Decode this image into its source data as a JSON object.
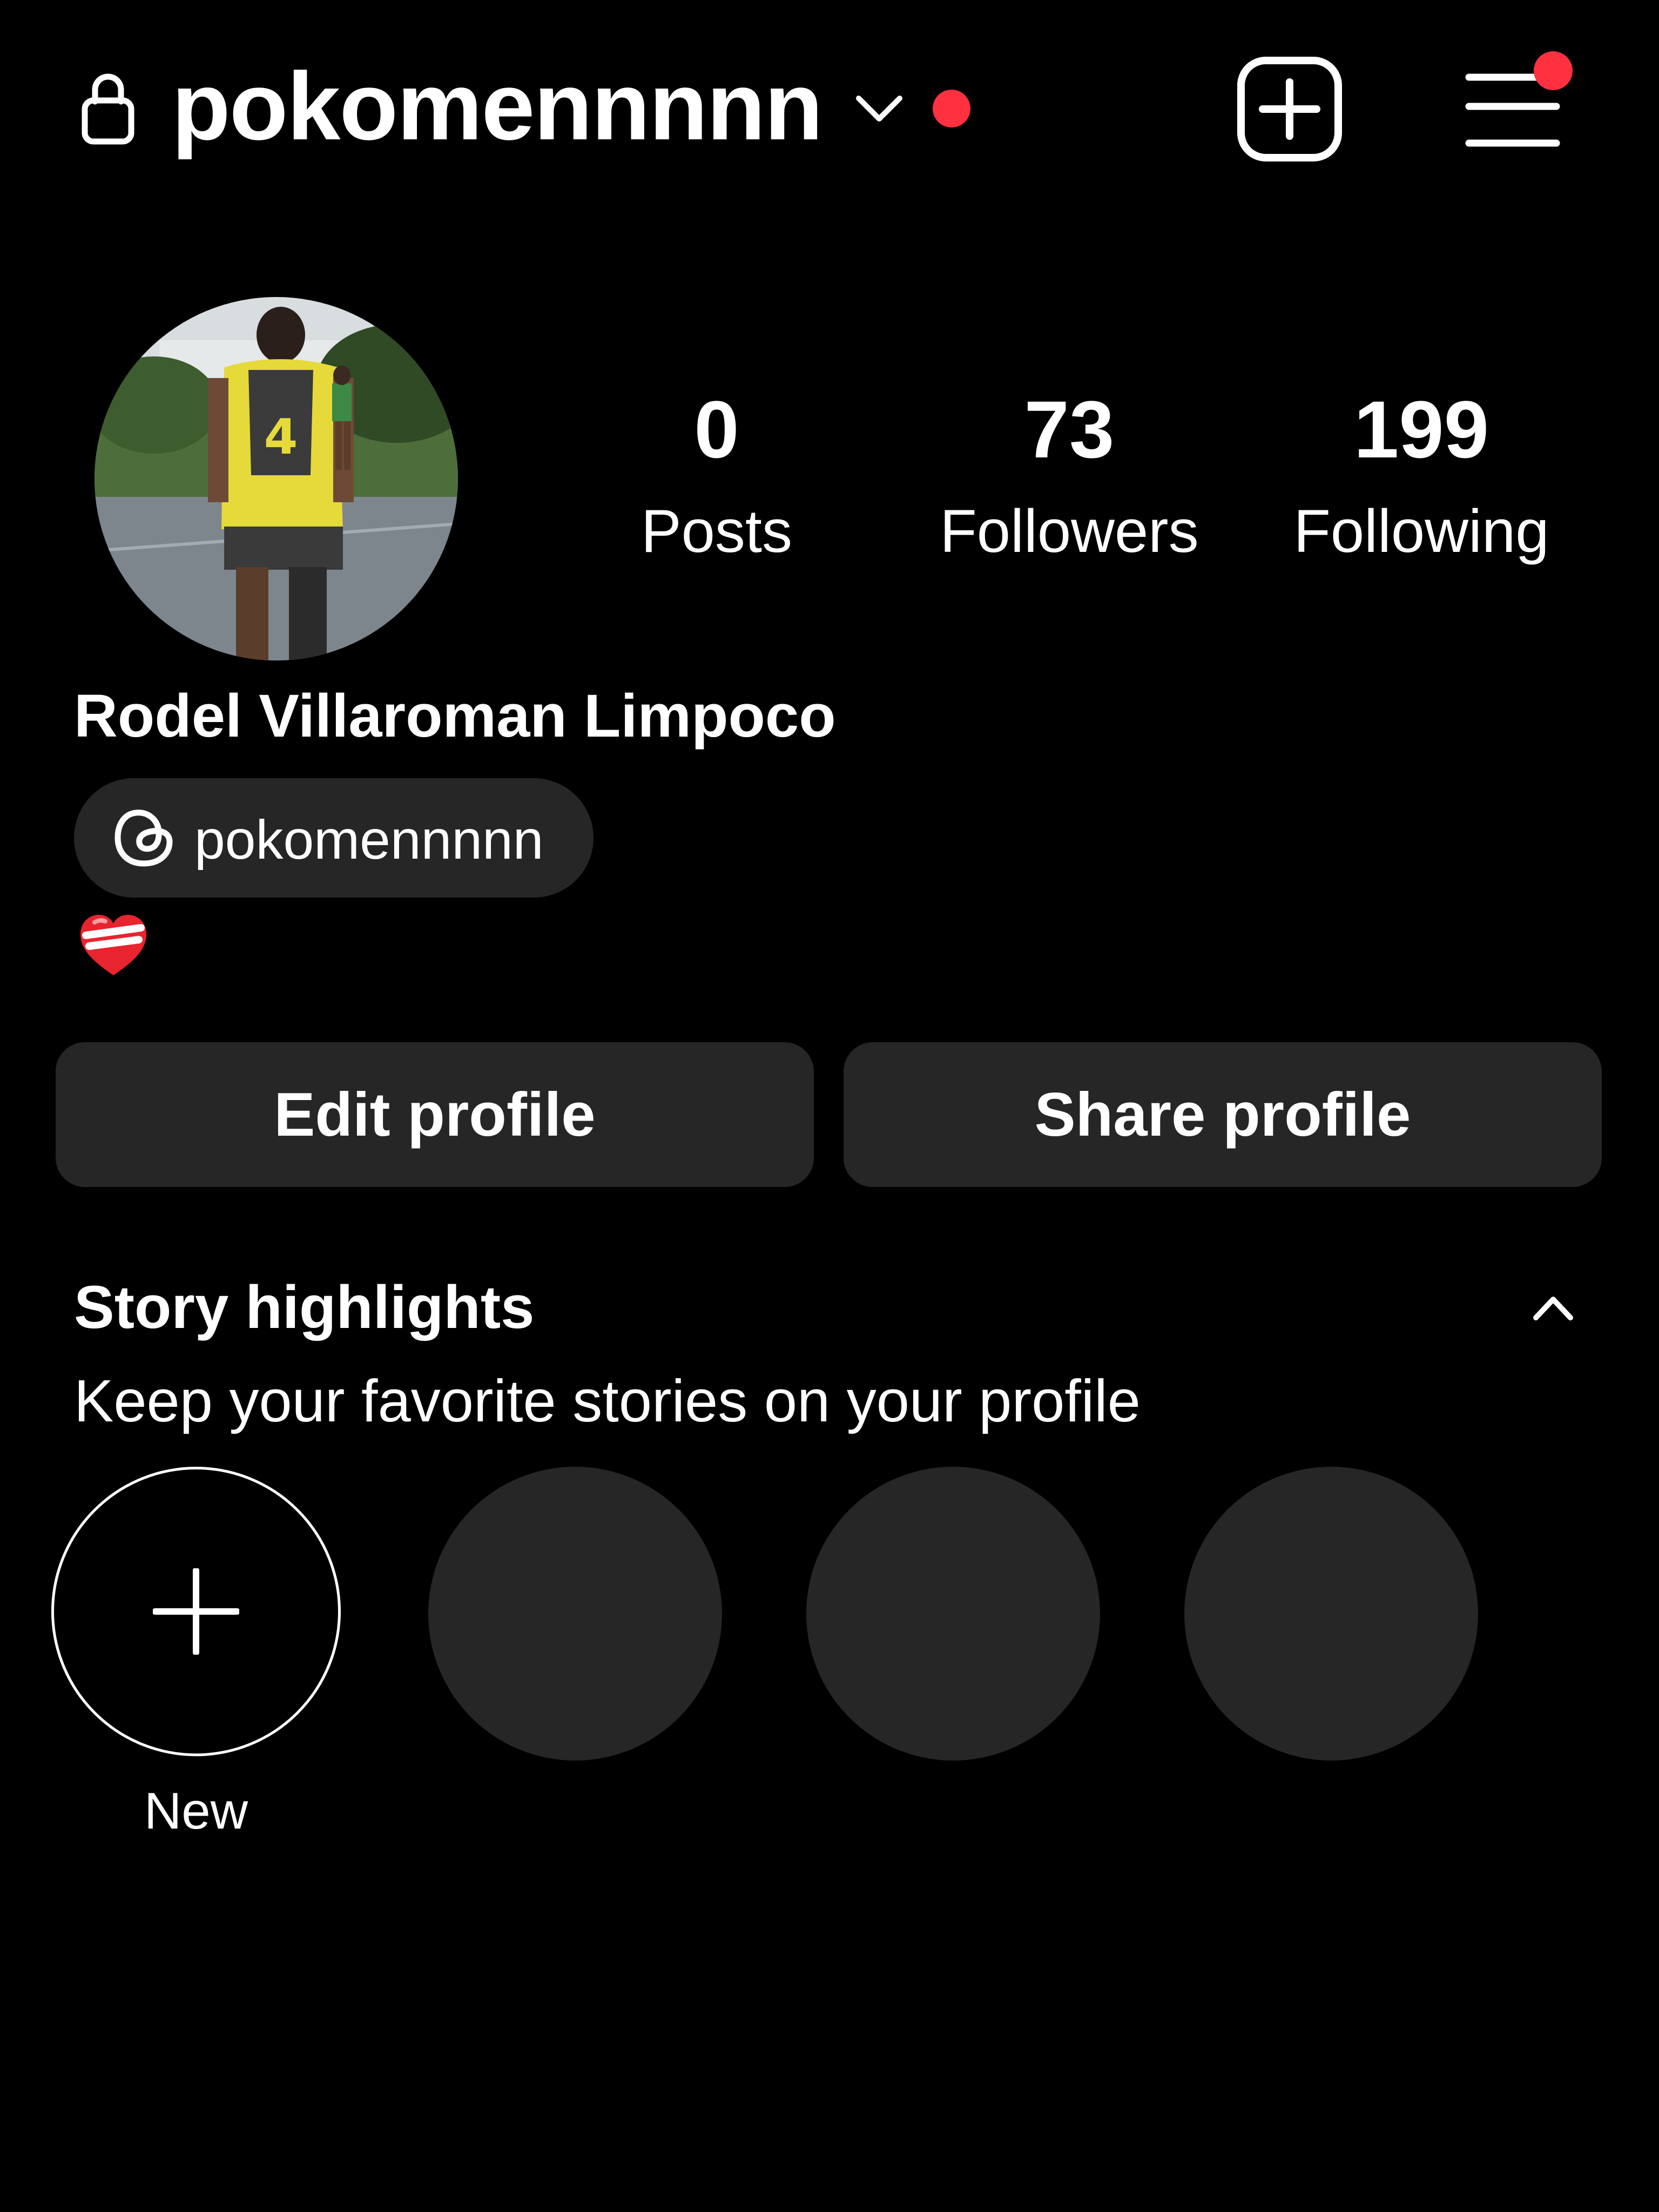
{
  "header": {
    "username": "pokomennnnn",
    "lock_icon": "lock-icon",
    "dropdown_icon": "chevron-down-icon",
    "create_icon": "plus-square-icon",
    "menu_icon": "hamburger-menu-icon"
  },
  "profile": {
    "avatar": "avatar-photo",
    "full_name": "Rodel Villaroman Limpoco",
    "threads_handle": "pokomennnnn",
    "threads_icon": "threads-icon",
    "bio_emoji": "heart-icon"
  },
  "stats": {
    "posts": {
      "count": "0",
      "label": "Posts"
    },
    "followers": {
      "count": "73",
      "label": "Followers"
    },
    "following": {
      "count": "199",
      "label": "Following"
    }
  },
  "actions": {
    "edit_profile": "Edit profile",
    "share_profile": "Share profile"
  },
  "highlights": {
    "title": "Story highlights",
    "subtitle": "Keep your favorite stories on your profile",
    "new_label": "New",
    "collapse_icon": "chevron-up-icon",
    "placeholder_count": 3
  },
  "colors": {
    "background": "#000000",
    "text": "#ffffff",
    "surface": "#262626",
    "notification": "#ff3040"
  }
}
